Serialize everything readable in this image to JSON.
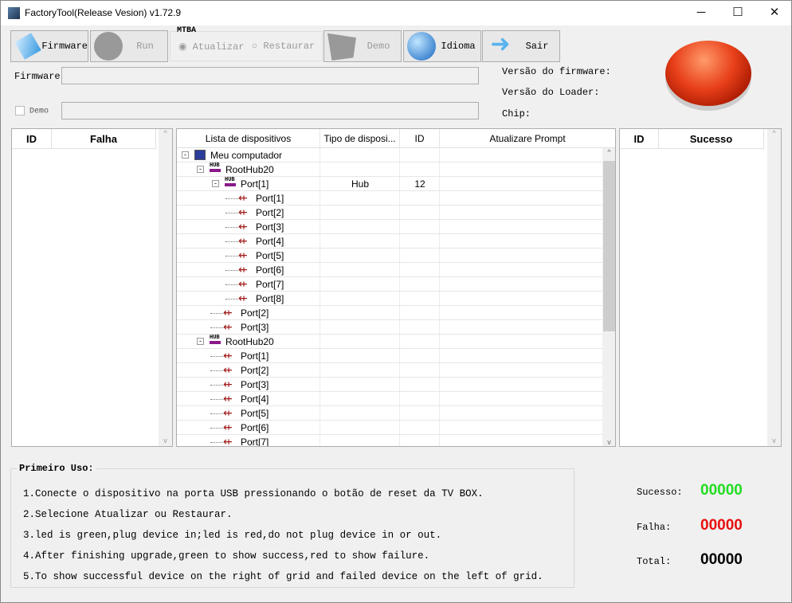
{
  "window": {
    "title": "FactoryTool(Release Vesion) v1.72.9",
    "minimize": "─",
    "maximize": "☐",
    "close": "✕"
  },
  "toolbar": {
    "firmware": "Firmware",
    "run": "Run",
    "mode_group": "MTBA",
    "atualizar": "Atualizar",
    "restaurar": "Restaurar",
    "demo": "Demo",
    "idioma": "Idioma",
    "sair": "Sair"
  },
  "firmware_label": "Firmware",
  "firmware_value": "",
  "demo_checkbox": "Demo",
  "demo_value": "",
  "info": {
    "fw_version": "Versão do firmware:",
    "loader_version": "Versão do Loader:",
    "chip": "Chip:"
  },
  "fail_grid": {
    "id": "ID",
    "col": "Falha"
  },
  "success_grid": {
    "id": "ID",
    "col": "Sucesso"
  },
  "device_grid": {
    "headers": [
      "Lista de dispositivos",
      "Tipo de disposi...",
      "ID",
      "Atualizare Prompt"
    ],
    "rows": [
      {
        "level": 0,
        "icon": "computer",
        "name": "Meu computador",
        "type": "",
        "id": ""
      },
      {
        "level": 1,
        "icon": "hub",
        "name": "RootHub20",
        "type": "",
        "id": ""
      },
      {
        "level": 2,
        "icon": "hub",
        "name": "Port[1]",
        "type": "Hub",
        "id": "12"
      },
      {
        "level": 3,
        "icon": "usb",
        "name": "Port[1]",
        "type": "",
        "id": ""
      },
      {
        "level": 3,
        "icon": "usb",
        "name": "Port[2]",
        "type": "",
        "id": ""
      },
      {
        "level": 3,
        "icon": "usb",
        "name": "Port[3]",
        "type": "",
        "id": ""
      },
      {
        "level": 3,
        "icon": "usb",
        "name": "Port[4]",
        "type": "",
        "id": ""
      },
      {
        "level": 3,
        "icon": "usb",
        "name": "Port[5]",
        "type": "",
        "id": ""
      },
      {
        "level": 3,
        "icon": "usb",
        "name": "Port[6]",
        "type": "",
        "id": ""
      },
      {
        "level": 3,
        "icon": "usb",
        "name": "Port[7]",
        "type": "",
        "id": ""
      },
      {
        "level": 3,
        "icon": "usb",
        "name": "Port[8]",
        "type": "",
        "id": ""
      },
      {
        "level": 2,
        "icon": "usb",
        "name": "Port[2]",
        "type": "",
        "id": ""
      },
      {
        "level": 2,
        "icon": "usb",
        "name": "Port[3]",
        "type": "",
        "id": ""
      },
      {
        "level": 1,
        "icon": "hub",
        "name": "RootHub20",
        "type": "",
        "id": ""
      },
      {
        "level": 2,
        "icon": "usb",
        "name": "Port[1]",
        "type": "",
        "id": ""
      },
      {
        "level": 2,
        "icon": "usb",
        "name": "Port[2]",
        "type": "",
        "id": ""
      },
      {
        "level": 2,
        "icon": "usb",
        "name": "Port[3]",
        "type": "",
        "id": ""
      },
      {
        "level": 2,
        "icon": "usb",
        "name": "Port[4]",
        "type": "",
        "id": ""
      },
      {
        "level": 2,
        "icon": "usb",
        "name": "Port[5]",
        "type": "",
        "id": ""
      },
      {
        "level": 2,
        "icon": "usb",
        "name": "Port[6]",
        "type": "",
        "id": ""
      },
      {
        "level": 2,
        "icon": "usb",
        "name": "Port[7]",
        "type": "",
        "id": ""
      }
    ]
  },
  "first_use": {
    "title": "Primeiro Uso:",
    "steps": [
      "1.Conecte o dispositivo na porta USB pressionando o botão de reset da TV BOX.",
      "2.Selecione Atualizar ou Restaurar.",
      "3.led is green,plug device in;led is red,do not plug device in or out.",
      "4.After finishing upgrade,green to show success,red to show failure.",
      "5.To show successful device on the right of grid and failed device on the left of grid."
    ]
  },
  "stats": {
    "success_label": "Sucesso:",
    "success_value": "00000",
    "fail_label": "Falha:",
    "fail_value": "00000",
    "total_label": "Total:",
    "total_value": "00000"
  },
  "colors": {
    "success": "#22dd22",
    "fail": "#e81010",
    "led": "#e8401a"
  }
}
